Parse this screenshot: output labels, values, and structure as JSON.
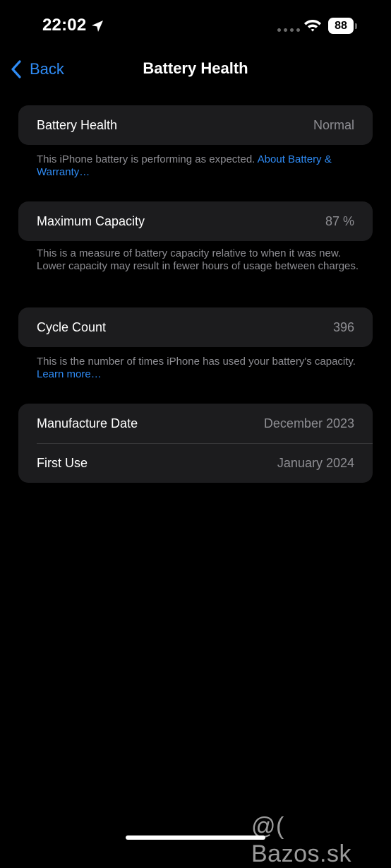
{
  "status_bar": {
    "time": "22:02",
    "battery_level": "88",
    "icons": [
      "location-arrow-icon",
      "signal-dots-icon",
      "wifi-icon",
      "battery-icon"
    ]
  },
  "nav": {
    "back_label": "Back",
    "title": "Battery Health",
    "back_icon": "chevron-left-icon",
    "accent_color": "#2f8cf6"
  },
  "battery_health": {
    "label": "Battery Health",
    "value": "Normal",
    "footer_text": "This iPhone battery is performing as expected. ",
    "footer_link": "About Battery & Warranty…"
  },
  "maximum_capacity": {
    "label": "Maximum Capacity",
    "value": "87 %",
    "footer_text": "This is a measure of battery capacity relative to when it was new. Lower capacity may result in fewer hours of usage between charges."
  },
  "cycle_count": {
    "label": "Cycle Count",
    "value": "396",
    "footer_text": "This is the number of times iPhone has used your battery's capacity. ",
    "footer_link": "Learn more…"
  },
  "dates": {
    "manufacture_label": "Manufacture Date",
    "manufacture_value": "December 2023",
    "first_use_label": "First Use",
    "first_use_value": "January 2024"
  },
  "watermark": "@( Bazos.sk"
}
